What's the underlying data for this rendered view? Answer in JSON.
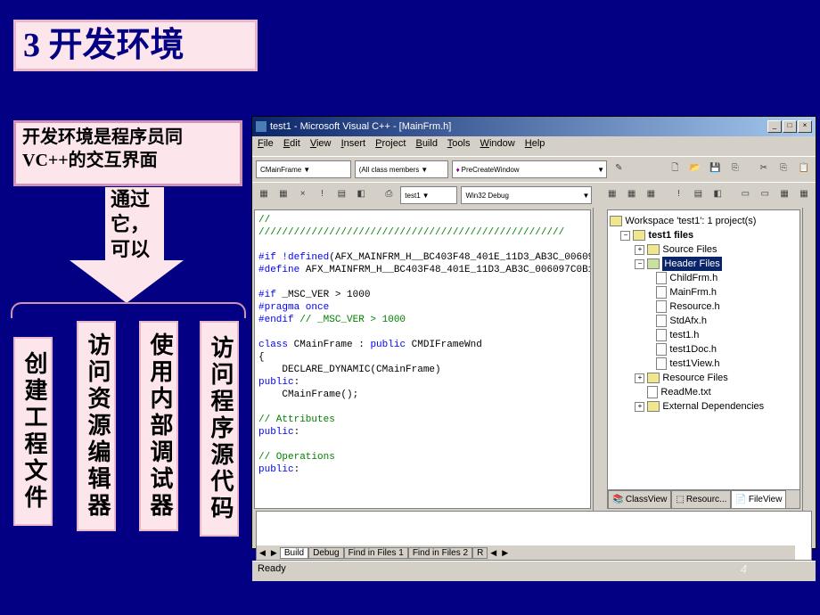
{
  "pageNumber": "4",
  "title": "3  开发环境",
  "desc_l1": "开发环境是程序员同",
  "desc_l2": "VC++的交互界面",
  "arrow_text": "通过它，可以",
  "vtabs": {
    "v1": "创建工程文件",
    "v2": "访问资源编辑器",
    "v3": "使用内部调试器",
    "v4": "访问程序源代码"
  },
  "ide": {
    "title": "test1 - Microsoft Visual C++ - [MainFrm.h]",
    "menu": {
      "file": "File",
      "edit": "Edit",
      "view": "View",
      "insert": "Insert",
      "project": "Project",
      "build": "Build",
      "tools": "Tools",
      "window": "Window",
      "help": "Help"
    },
    "tb1": {
      "combo1": "CMainFrame",
      "combo2": "(All class members",
      "combo3": "PreCreateWindow"
    },
    "tb2": {
      "combo1": "test1",
      "combo2": "Win32 Debug"
    },
    "code": {
      "l1": "//",
      "l2": "////////////////////////////////////////////////////",
      "l3a": "#if ",
      "l3b": "!defined",
      "l3c": "(AFX_MAINFRM_H__BC403F48_401E_11D3_AB3C_00609",
      "l4a": "#define",
      "l4b": " AFX_MAINFRM_H__BC403F48_401E_11D3_AB3C_006097C0B1",
      "l5": "#if",
      "l5b": " _MSC_VER > 1000",
      "l6": "#pragma once",
      "l7a": "#endif",
      "l7b": " // _MSC_VER > 1000",
      "l8a": "class",
      "l8b": " CMainFrame : ",
      "l8c": "public",
      "l8d": " CMDIFrameWnd",
      "l9": "{",
      "l10": "    DECLARE_DYNAMIC(CMainFrame)",
      "l11": "public",
      "l11b": ":",
      "l12": "    CMainFrame();",
      "l13": "// Attributes",
      "l14": "public",
      "l14b": ":",
      "l15": "// Operations",
      "l16": "public",
      "l16b": ":"
    },
    "tree": {
      "ws": "Workspace 'test1': 1 project(s)",
      "prj": "test1 files",
      "src": "Source Files",
      "hdr": "Header Files",
      "h1": "ChildFrm.h",
      "h2": "MainFrm.h",
      "h3": "Resource.h",
      "h4": "StdAfx.h",
      "h5": "test1.h",
      "h6": "test1Doc.h",
      "h7": "test1View.h",
      "res": "Resource Files",
      "readme": "ReadMe.txt",
      "ext": "External Dependencies",
      "tab_cv": "ClassView",
      "tab_rv": "Resourc...",
      "tab_fv": "FileView"
    },
    "out_tabs": {
      "t1": "Build",
      "t2": "Debug",
      "t3": "Find in Files 1",
      "t4": "Find in Files 2",
      "t5": "R"
    },
    "status": "Ready"
  }
}
